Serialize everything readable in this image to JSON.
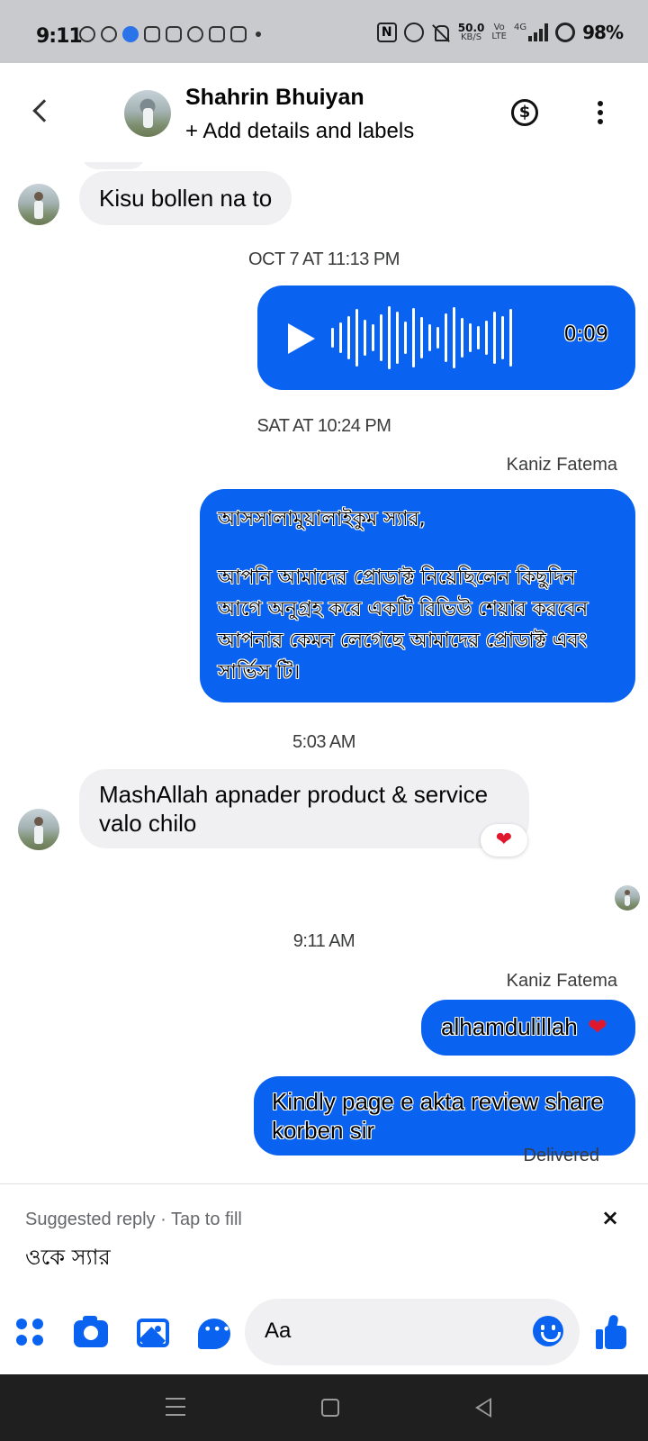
{
  "status_bar": {
    "time": "9:11",
    "speed_value": "50.0",
    "speed_unit": "KB/S",
    "volte": "Vo",
    "lte": "LTE",
    "network": "4G",
    "battery": "98%"
  },
  "header": {
    "contact_name": "Shahrin Bhuiyan",
    "subtitle": "+ Add details and labels",
    "payment_symbol": "$"
  },
  "messages": {
    "m1_text": "Kisu bollen na to",
    "ts1": "OCT 7 AT 11:13 PM",
    "audio_duration": "0:09",
    "ts2": "SAT AT 10:24 PM",
    "sender1": "Kaniz Fatema",
    "bangla_line1": "আসসালামুয়ালাইকুম স্যার,",
    "bangla_para": " আপনি আমাদের প্রোডাক্ট নিয়েছিলেন কিছুদিন আগে অনুগ্রহ করে একটি রিভিউ শেয়ার করবেন আপনার কেমন লেগেছে আমাদের প্রোডাক্ট এবং সার্ভিস টি।",
    "ts3": "5:03 AM",
    "m4_text": "MashAllah apnader product & service valo chilo",
    "reaction": "❤",
    "ts4": "9:11 AM",
    "sender2": "Kaniz Fatema",
    "m5_text": "alhamdulillah",
    "m5_heart": "❤",
    "m6_text": "Kindly page e akta review share korben sir",
    "delivered": "Delivered"
  },
  "suggested_reply": {
    "label": "Suggested reply · Tap to fill",
    "text": "ওকে স্যার",
    "close": "×"
  },
  "composer": {
    "placeholder": "Aa"
  },
  "icons": [
    "back-icon",
    "dollar-icon",
    "more-icon",
    "play-icon",
    "apps-icon",
    "camera-icon",
    "gallery-icon",
    "messenger-icon",
    "emoji-icon",
    "like-icon",
    "close-icon"
  ],
  "colors": {
    "accent": "#0a63f0",
    "incoming_bubble": "#f0f0f2",
    "status_bar": "#c9cacd",
    "nav_bar": "#1f1f1f"
  }
}
